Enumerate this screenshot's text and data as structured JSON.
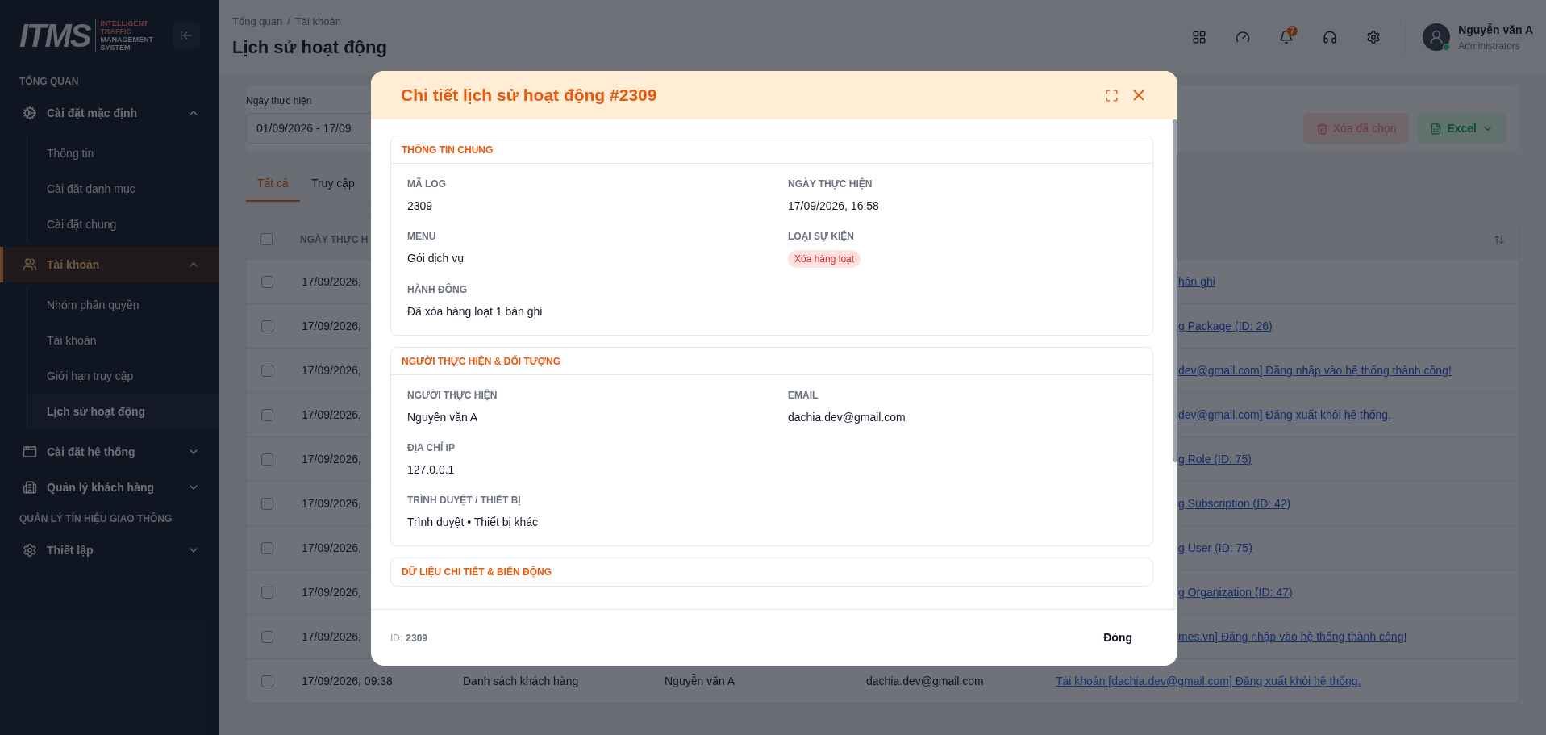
{
  "sidebar": {
    "logo": {
      "mark": "ITMS",
      "tagline": [
        "INTELLIGENT",
        "TRAFFIC",
        "MANAGEMENT",
        "SYSTEM"
      ]
    },
    "groups": [
      {
        "heading": "TỔNG QUAN",
        "items": [
          {
            "label": "Cài đặt mặc định",
            "selected": false,
            "expanded": true,
            "children": [
              {
                "label": "Thông tin",
                "selected": false
              },
              {
                "label": "Cài đặt danh mục",
                "selected": false
              },
              {
                "label": "Cài đặt chung",
                "selected": false
              }
            ]
          },
          {
            "label": "Tài khoản",
            "selected": true,
            "expanded": true,
            "children": [
              {
                "label": "Nhóm phân quyền",
                "selected": false
              },
              {
                "label": "Tài khoản",
                "selected": false
              },
              {
                "label": "Giới hạn truy cập",
                "selected": false
              },
              {
                "label": "Lịch sử hoạt động",
                "selected": true
              }
            ]
          },
          {
            "label": "Cài đặt hệ thống",
            "selected": false,
            "expanded": false
          },
          {
            "label": "Quản lý khách hàng",
            "selected": false,
            "expanded": false
          }
        ]
      },
      {
        "heading": "QUẢN LÝ TÍN HIỆU GIAO THÔNG",
        "items": [
          {
            "label": "Thiết lập",
            "selected": false,
            "expanded": false
          }
        ]
      }
    ]
  },
  "header": {
    "breadcrumb": [
      "Tổng quan",
      "Tài khoản"
    ],
    "breadcrumb_separator": "/",
    "title": "Lịch sử hoạt động",
    "notification_count": "7",
    "user": {
      "name": "Nguyễn văn A",
      "role": "Administrators"
    }
  },
  "filter": {
    "label": "Ngày thực hiện",
    "value": "01/09/2026 - 17/09",
    "delete_button": "Xóa đã chọn",
    "export_button": "Excel"
  },
  "tabs": [
    {
      "label": "Tất cả",
      "selected": true
    },
    {
      "label": "Truy cập",
      "selected": false
    }
  ],
  "table": {
    "header_checked": false,
    "columns": [
      "NGÀY THỰC H"
    ],
    "rows": [
      {
        "kind": "covered",
        "checked": false,
        "date": "17/09/2026,",
        "action": "hản ghi"
      },
      {
        "kind": "covered",
        "checked": false,
        "date": "17/09/2026,",
        "action": "g Package (ID: 26)"
      },
      {
        "kind": "covered",
        "checked": false,
        "date": "17/09/2026,",
        "action": "dev@gmail.com] Đăng nhập vào hệ thống thành công!"
      },
      {
        "kind": "covered",
        "checked": false,
        "date": "17/09/2026,",
        "action": "dev@gmail.com] Đăng xuất khỏi hệ thống."
      },
      {
        "kind": "covered",
        "checked": false,
        "date": "17/09/2026,",
        "action": "g Role (ID: 75)"
      },
      {
        "kind": "covered",
        "checked": false,
        "date": "17/09/2026,",
        "action": "g Subscription (ID: 42)"
      },
      {
        "kind": "covered",
        "checked": false,
        "date": "17/09/2026,",
        "action": "g User (ID: 75)"
      },
      {
        "kind": "covered",
        "checked": false,
        "date": "17/09/2026,",
        "action": "g Organization (ID: 47)"
      },
      {
        "kind": "covered",
        "checked": false,
        "date": "17/09/2026,",
        "action": "mes.vn] Đăng nhập vào hệ thống thành công!"
      },
      {
        "kind": "full",
        "checked": false,
        "date": "17/09/2026, 09:38",
        "menu": "Danh sách khách hàng",
        "user": "Nguyễn văn A",
        "email": "dachia.dev@gmail.com",
        "action": "Tài khoản [dachia.dev@gmail.com] Đăng xuất khỏi hệ thống."
      }
    ]
  },
  "modal": {
    "title": "Chi tiết lịch sử hoạt động #2309",
    "sections": [
      {
        "title": "THÔNG TIN CHUNG",
        "fields": [
          {
            "kind": "text",
            "label": "MÃ LOG",
            "value": "2309"
          },
          {
            "kind": "text",
            "label": "NGÀY THỰC HIỆN",
            "value": "17/09/2026, 16:58"
          },
          {
            "kind": "text",
            "label": "MENU",
            "value": "Gói dịch vụ"
          },
          {
            "kind": "tag",
            "label": "LOẠI SỰ KIỆN",
            "value": "Xóa hàng loạt",
            "color": "#dc2626"
          },
          {
            "kind": "text",
            "label": "HÀNH ĐỘNG",
            "value": "Đã xóa hàng loạt 1 bản ghi"
          }
        ]
      },
      {
        "title": "NGƯỜI THỰC HIỆN & ĐỐI TƯỢNG",
        "fields": [
          {
            "kind": "text",
            "label": "NGƯỜI THỰC HIỆN",
            "value": "Nguyễn văn A"
          },
          {
            "kind": "text",
            "label": "EMAIL",
            "value": "dachia.dev@gmail.com"
          },
          {
            "kind": "text",
            "label": "ĐỊA CHỈ IP",
            "value": "127.0.0.1"
          },
          {
            "kind": "empty"
          },
          {
            "kind": "text",
            "label": "TRÌNH DUYỆT / THIẾT BỊ",
            "value": "Trình duyệt • Thiết bị khác"
          }
        ]
      },
      {
        "title": "DỮ LIỆU CHI TIẾT & BIẾN ĐỘNG"
      }
    ],
    "footer": {
      "id_label": "ID:",
      "id_value": "2309",
      "close_button": "Đóng"
    }
  }
}
